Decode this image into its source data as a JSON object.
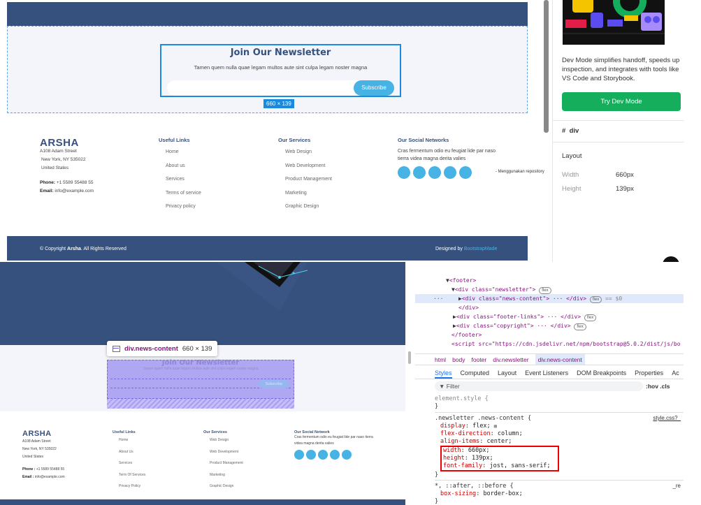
{
  "top": {
    "newsletter": {
      "title": "Join Our Newsletter",
      "text": "Tamen quem nulla quae legam multos aute sint culpa legam noster magna",
      "button": "Subscribe",
      "dimensions": "660 × 139"
    },
    "footer": {
      "brand": "ARSHA",
      "address": [
        "A108 Adam Street",
        "New York, NY 535022",
        "United States"
      ],
      "phone_label": "Phone:",
      "phone": "+1 5589 55488 55",
      "email_label": "Email:",
      "email": "info@example.com",
      "useful_links_title": "Useful Links",
      "useful_links": [
        "Home",
        "About us",
        "Services",
        "Terms of service",
        "Privacy policy"
      ],
      "services_title": "Our Services",
      "services": [
        "Web Design",
        "Web Development",
        "Product Management",
        "Marketing",
        "Graphic Design"
      ],
      "social_title": "Our Social Networks",
      "social_text": "Cras fermentum odio eu feugiat lide par naso tierra videa magna derita valies",
      "copyright_pre": "© Copyright",
      "copyright_brand": "Arsha",
      "copyright_post": ". All Rights Reserved",
      "designed_by": "Designed by",
      "designed_by_link": "BootstrapMade"
    },
    "side_note": "- Menggunakan repository",
    "figma_panel": {
      "description": "Dev Mode simplifies handoff, speeds up inspection, and integrates with tools like VS Code and Storybook.",
      "button": "Try Dev Mode",
      "element_tag": "div",
      "layout_title": "Layout",
      "width_label": "Width",
      "width_value": "660px",
      "height_label": "Height",
      "height_value": "139px"
    }
  },
  "bottom": {
    "newsletter": {
      "title": "Join Our Newsletter",
      "text": "Tamen quem nulla quae legam multos aute sint culpa legam noster magna",
      "button": "Subscribe"
    },
    "tooltip": {
      "selector": "div.news-content",
      "size": "660 × 139"
    },
    "footer": {
      "brand": "ARSHA",
      "address": [
        "A108 Adam Street",
        "New York, NY 535022",
        "United States"
      ],
      "phone_label": "Phone :",
      "phone": "+1 5589 55488 55",
      "email_label": "Email :",
      "email": "info@example.com",
      "useful_links_title": "Useful Links",
      "useful_links": [
        "Home",
        "About Us",
        "Services",
        "Term Of Services",
        "Privacy Policy"
      ],
      "services_title": "Our Services",
      "services": [
        "Web Design",
        "Web Development",
        "Product Management",
        "Marketing",
        "Graphic Design"
      ],
      "social_title": "Our Social Network",
      "social_text": "Cras fermentum odio eu feugiat lide par naso tierra videa magna derita valies"
    },
    "devtools": {
      "dom": [
        "<footer>",
        "<div class=\"newsletter\">",
        "<div class=\"news-content\"> ··· </div>",
        "</div>",
        "<div class=\"footer-links\"> ··· </div>",
        "<div class=\"copyright\"> ··· </div>",
        "</footer>",
        "<script src=\"https://cdn.jsdelivr.net/npm/bootstrap@5.0.2/dist/js/bo"
      ],
      "pill_flex": "flex",
      "eq": "== $0",
      "breadcrumb": [
        "html",
        "body",
        "footer",
        "div.newsletter",
        "div.news-content"
      ],
      "tabs": [
        "Styles",
        "Computed",
        "Layout",
        "Event Listeners",
        "DOM Breakpoints",
        "Properties",
        "Ac"
      ],
      "filter": "Filter",
      "filter_right": ":hov .cls",
      "element_style": "element.style {",
      "close_brace": "}",
      "rule_selector": ".newsletter .news-content {",
      "rule_source": "style.css?_",
      "rule_props": [
        [
          "display",
          "flex;"
        ],
        [
          "flex-direction",
          "column;"
        ],
        [
          "align-items",
          "center;"
        ],
        [
          "width",
          "660px;"
        ],
        [
          "height",
          "139px;"
        ],
        [
          "font-family",
          "jost, sans-serif;"
        ]
      ],
      "universal_selector": "*, ::after, ::before {",
      "universal_source": "_re",
      "universal_prop": [
        "box-sizing",
        "border-box;"
      ]
    }
  }
}
